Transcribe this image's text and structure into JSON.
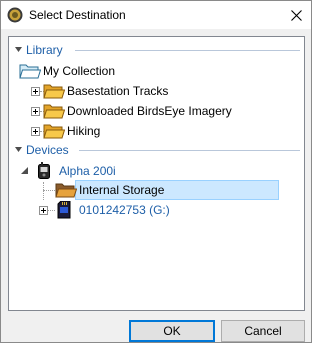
{
  "window": {
    "title": "Select Destination"
  },
  "tree": {
    "library": {
      "header": "Library",
      "root": "My Collection",
      "children": [
        "Basestation Tracks",
        "Downloaded BirdsEye Imagery",
        "Hiking"
      ]
    },
    "devices": {
      "header": "Devices",
      "device": "Alpha 200i",
      "items": [
        "Internal Storage",
        "0101242753 (G:)"
      ],
      "selected": "Internal Storage"
    }
  },
  "buttons": {
    "ok": "OK",
    "cancel": "Cancel"
  },
  "colors": {
    "group_header": "#1e5fa8",
    "device_text": "#1e5fa8",
    "selection": "#cce8ff",
    "folder": "#f5c242"
  }
}
